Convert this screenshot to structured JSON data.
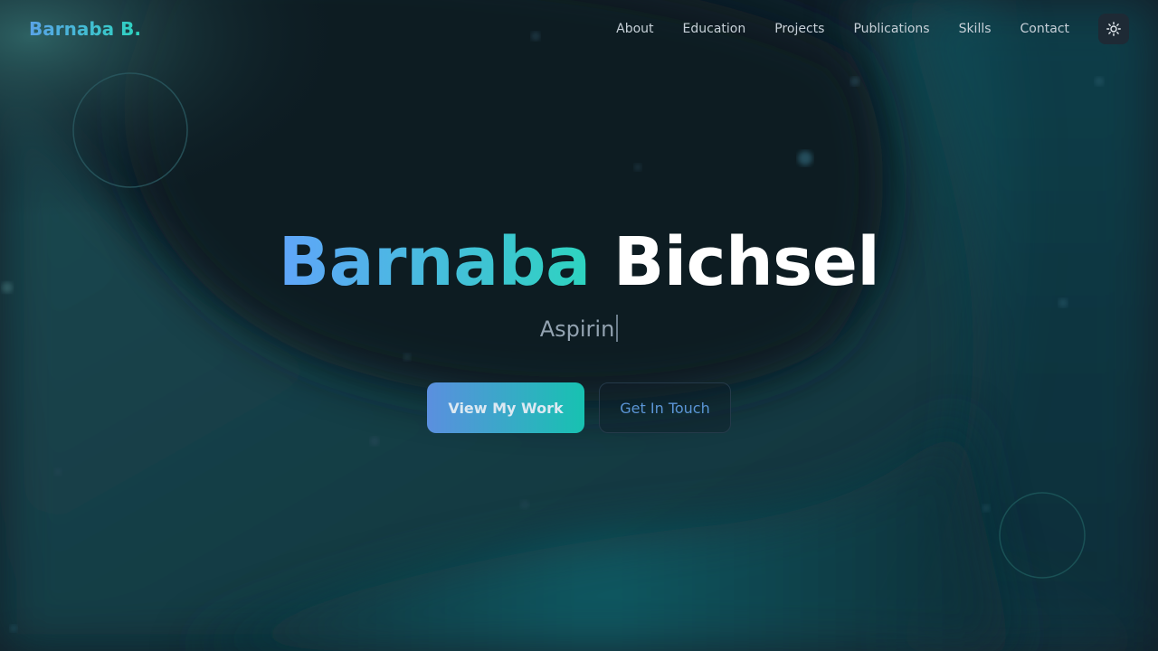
{
  "nav": {
    "logo": "Barnaba B.",
    "links": [
      "About",
      "Education",
      "Projects",
      "Publications",
      "Skills",
      "Contact"
    ],
    "theme_toggle_icon": "sun-icon"
  },
  "hero": {
    "first_name": "Barnaba",
    "last_name": "Bichsel",
    "typed_text": "Aspirin",
    "primary_button": "View My Work",
    "secondary_button": "Get In Touch"
  },
  "colors": {
    "accent_start": "#60a5fa",
    "accent_end": "#2dd4bf",
    "background": "#0f1e28"
  }
}
